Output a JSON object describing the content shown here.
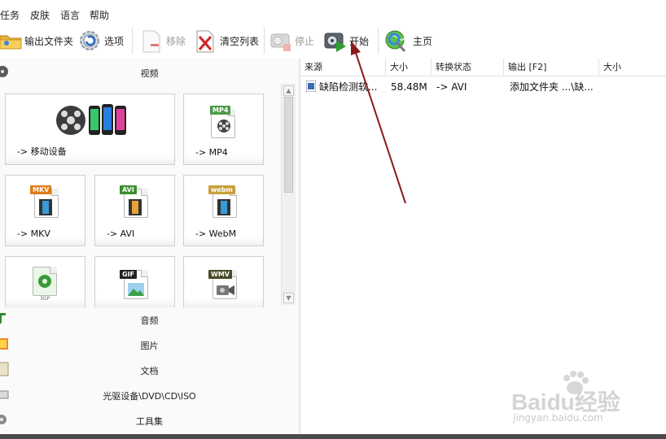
{
  "menu": [
    "任务",
    "皮肤",
    "语言",
    "帮助"
  ],
  "toolbar": {
    "add_folder": "输出文件夹",
    "options": "选项",
    "remove": "移除",
    "clear_list": "清空列表",
    "stop": "停止",
    "start": "开始",
    "home": "主页"
  },
  "sidebar": {
    "video_header": "视频",
    "tiles": [
      {
        "label": "-> 移动设备"
      },
      {
        "label": "-> MP4",
        "tag": "MP4"
      },
      {
        "label": "-> MKV",
        "tag": "MKV"
      },
      {
        "label": "-> AVI",
        "tag": "AVI"
      },
      {
        "label": "-> WebM",
        "tag": "webm"
      },
      {
        "label": "",
        "tag": "3GP"
      },
      {
        "label": "",
        "tag": "GIF"
      },
      {
        "label": "",
        "tag": "WMV"
      }
    ],
    "categories": [
      "音频",
      "图片",
      "文档",
      "光驱设备\\DVD\\CD\\ISO",
      "工具集"
    ]
  },
  "list": {
    "columns": [
      "来源",
      "大小",
      "转换状态",
      "输出 [F2]",
      "大小"
    ],
    "rows": [
      {
        "source": "缺陷检测软...",
        "size": "58.48M",
        "status": "-> AVI",
        "output": "添加文件夹 ...\\缺...",
        "out_size": ""
      }
    ]
  },
  "watermark": {
    "brand": "Baidu经验",
    "url": "jingyan.baidu.com"
  },
  "colors": {
    "accent_arrow": "#8b1a1a",
    "start_green": "#2e9e2e"
  }
}
